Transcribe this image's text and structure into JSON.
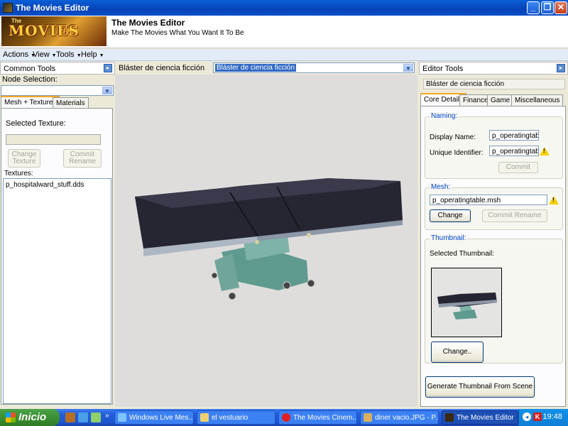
{
  "window": {
    "title": "The Movies Editor"
  },
  "banner": {
    "logo_small": "The",
    "logo_text": "MOVIES",
    "title": "The Movies Editor",
    "subtitle": "Make The Movies What You Want It To Be"
  },
  "menu": [
    {
      "label": "Actions"
    },
    {
      "label": "View"
    },
    {
      "label": "Tools"
    },
    {
      "label": "Help"
    }
  ],
  "left": {
    "header": "Common Tools",
    "node_selection_label": "Node Selection:",
    "node_selection_value": "",
    "tabs": [
      "Mesh + Textures",
      "Materials"
    ],
    "selected_texture_label": "Selected Texture:",
    "selected_texture_value": "",
    "change_texture": "Change\nTexture",
    "commit_rename": "Commit\nRename",
    "textures_label": "Textures:",
    "textures": [
      "p_hospitalward_stuff.dds"
    ]
  },
  "center": {
    "object_label": "Bláster de ciencia ficción",
    "object_dropdown": "Bláster de ciencia ficción"
  },
  "right": {
    "header": "Editor Tools",
    "object_name": "Bláster de ciencia ficción",
    "tabs": [
      "Core Details",
      "Finance",
      "Game",
      "Miscellaneous"
    ],
    "naming": {
      "title": "Naming:",
      "display_name_label": "Display Name:",
      "display_name": "p_operatingtable",
      "unique_id_label": "Unique Identifier:",
      "unique_id": "p_operatingtable",
      "commit": "Commit"
    },
    "mesh": {
      "title": "Mesh:",
      "value": "p_operatingtable.msh",
      "change": "Change",
      "commit_rename": "Commit Rename"
    },
    "thumbnail": {
      "title": "Thumbnail:",
      "label": "Selected Thumbnail:",
      "change": "Change.."
    },
    "generate": "Generate Thumbnail  From Scene"
  },
  "taskbar": {
    "start": "Inicio",
    "tasks": [
      "Windows Live Mes...",
      "el vestuario",
      "The Movies Cinem...",
      "diner vacio.JPG - P...",
      "The Movies Editor"
    ],
    "clock": "19:48"
  },
  "colors": {
    "titlebar": "#0842b8",
    "accent_tab": "#f5a623",
    "group_title": "#0046d5",
    "table_pad": "#262633",
    "table_base": "#6fa59a"
  }
}
